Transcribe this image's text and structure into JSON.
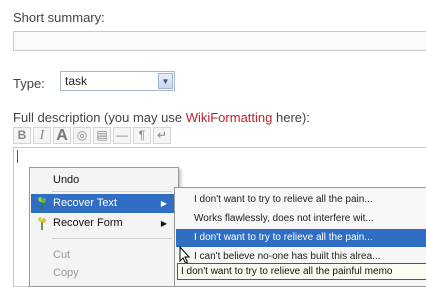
{
  "form": {
    "summary_label": "Short summary:",
    "type_label": "Type:",
    "type_value": "task",
    "desc_label_before": "Full description (you may use ",
    "desc_label_link": "WikiFormatting",
    "desc_label_after": " here):"
  },
  "toolbar": {
    "buttons": [
      {
        "icon": "bold-icon",
        "glyph": "B"
      },
      {
        "icon": "italic-icon",
        "glyph": "I"
      },
      {
        "icon": "heading-icon",
        "glyph": "A"
      },
      {
        "icon": "link-icon",
        "glyph": "◎"
      },
      {
        "icon": "code-block-icon",
        "glyph": "▤"
      },
      {
        "icon": "horizontal-rule-icon",
        "glyph": "—"
      },
      {
        "icon": "paragraph-icon",
        "glyph": "¶"
      },
      {
        "icon": "line-break-icon",
        "glyph": "↵"
      }
    ]
  },
  "context_menu": {
    "undo": "Undo",
    "recover_text": "Recover Text",
    "recover_form": "Recover Form",
    "cut": "Cut",
    "copy": "Copy"
  },
  "submenu": {
    "items": [
      "I don't want to try to relieve all the pain...",
      "Works flawlessly, does not interfere wit...",
      "I don't want to try to relieve all the pain...",
      "I can't believe no-one has built this alrea..."
    ],
    "highlighted_index": 2
  },
  "tooltip": "I don't want to try to relieve all the painful memo"
}
